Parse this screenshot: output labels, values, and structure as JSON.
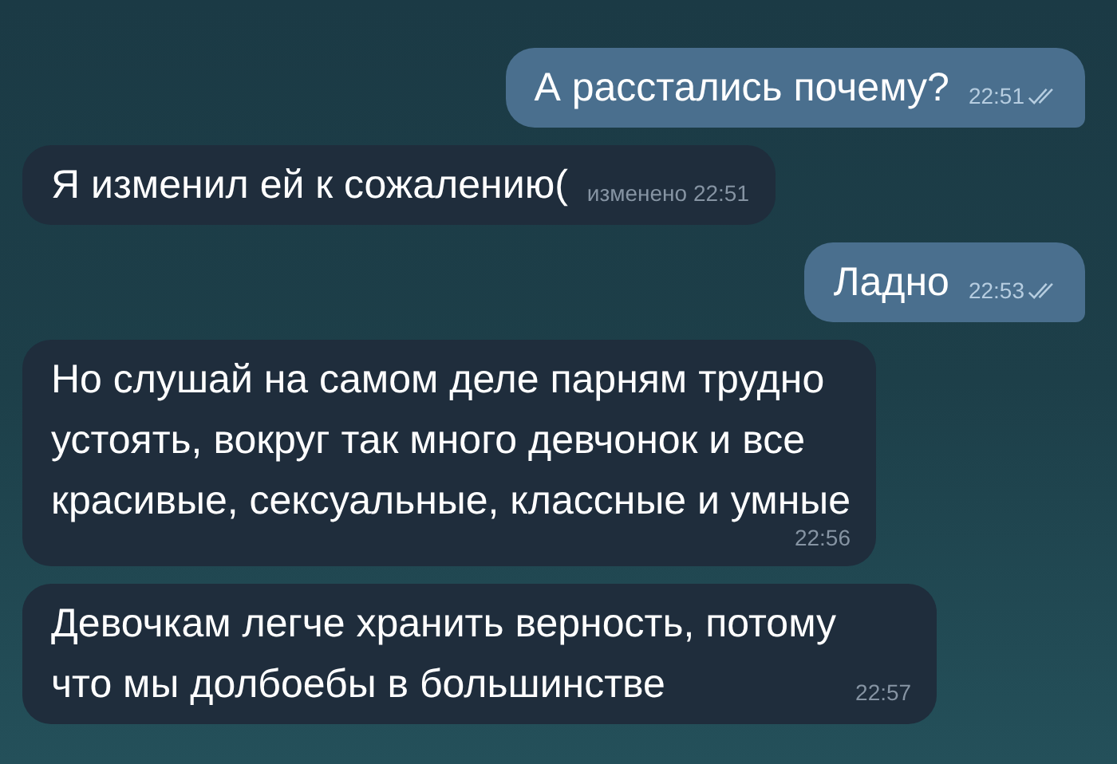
{
  "messages": [
    {
      "kind": "outgoing",
      "lines": [
        "А расстались почему?"
      ],
      "time": "22:51",
      "read": true
    },
    {
      "kind": "incoming",
      "lines": [
        "Я изменил ей к сожалению("
      ],
      "time": "изменено 22:51"
    },
    {
      "kind": "outgoing",
      "lines": [
        "Ладно"
      ],
      "time": "22:53",
      "read": true
    },
    {
      "kind": "incoming",
      "lines": [
        "Но слушай на самом деле парням трудно",
        "устоять, вокруг так много девчонок и все",
        "красивые, сексуальные, классные и умные"
      ],
      "time": "22:56"
    },
    {
      "kind": "incoming",
      "lines": [
        "Девочкам легче хранить верность, потому",
        "что мы долбоебы в большинстве"
      ],
      "time": "22:57"
    }
  ]
}
